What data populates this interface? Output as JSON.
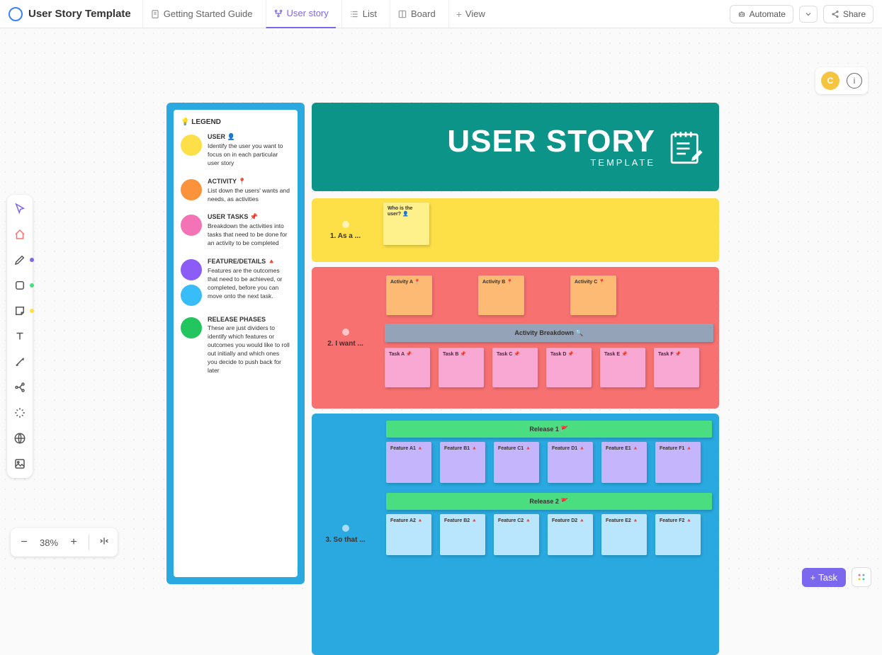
{
  "header": {
    "page_title": "User Story Template",
    "tabs": [
      {
        "label": "Getting Started Guide",
        "icon": "doc"
      },
      {
        "label": "User story",
        "icon": "hierarchy",
        "active": true
      },
      {
        "label": "List",
        "icon": "list"
      },
      {
        "label": "Board",
        "icon": "board"
      },
      {
        "label": "View",
        "icon": "plus"
      }
    ],
    "automate_label": "Automate",
    "share_label": "Share",
    "avatar_initial": "C"
  },
  "zoom": {
    "level": "38%"
  },
  "task_button": "Task",
  "legend": {
    "title": "💡 LEGEND",
    "items": [
      {
        "color": "#fde047",
        "label": "USER 👤",
        "desc": "Identify the user you want to focus on in each particular user story"
      },
      {
        "color": "#fb923c",
        "label": "ACTIVITY 📍",
        "desc": "List down the users' wants and needs, as activities"
      },
      {
        "color": "#f472b6",
        "label": "USER TASKS 📌",
        "desc": "Breakdown the activities into tasks that need to be done for an activity to be completed"
      },
      {
        "color": "#8b5cf6",
        "label": "FEATURE/DETAILS 🔺",
        "desc": "Features are the outcomes that need to be achieved, or completed, before you can move onto the next task."
      },
      {
        "color2": "#38bdf8",
        "skip": true
      },
      {
        "color": "#22c55e",
        "label": "RELEASE PHASES",
        "desc": "These are just dividers to identify which features or outcomes you would like to roll out initially and which ones you decide to push back for later"
      }
    ]
  },
  "banner": {
    "main": "USER STORY",
    "sub": "TEMPLATE"
  },
  "sections": {
    "yellow": {
      "label": "1. As a ...",
      "note": "Who is the user?\n👤"
    },
    "red": {
      "label": "2. I want ...",
      "activities": [
        "Activity A 📍",
        "Activity B 📍",
        "Activity C 📍"
      ],
      "breakdown": "Activity Breakdown 🔍",
      "tasks": [
        "Task A 📌",
        "Task B 📌",
        "Task C 📌",
        "Task D 📌",
        "Task E 📌",
        "Task F 📌"
      ]
    },
    "blue": {
      "label": "3. So that ...",
      "release1": {
        "title": "Release 1 🚩",
        "features": [
          "Feature A1 🔺",
          "Feature B1 🔺",
          "Feature C1 🔺",
          "Feature D1 🔺",
          "Feature E1 🔺",
          "Feature F1 🔺"
        ]
      },
      "release2": {
        "title": "Release 2 🚩",
        "features": [
          "Feature A2 🔺",
          "Feature B2 🔺",
          "Feature C2 🔺",
          "Feature D2 🔺",
          "Feature E2 🔺",
          "Feature F2 🔺"
        ]
      }
    }
  }
}
